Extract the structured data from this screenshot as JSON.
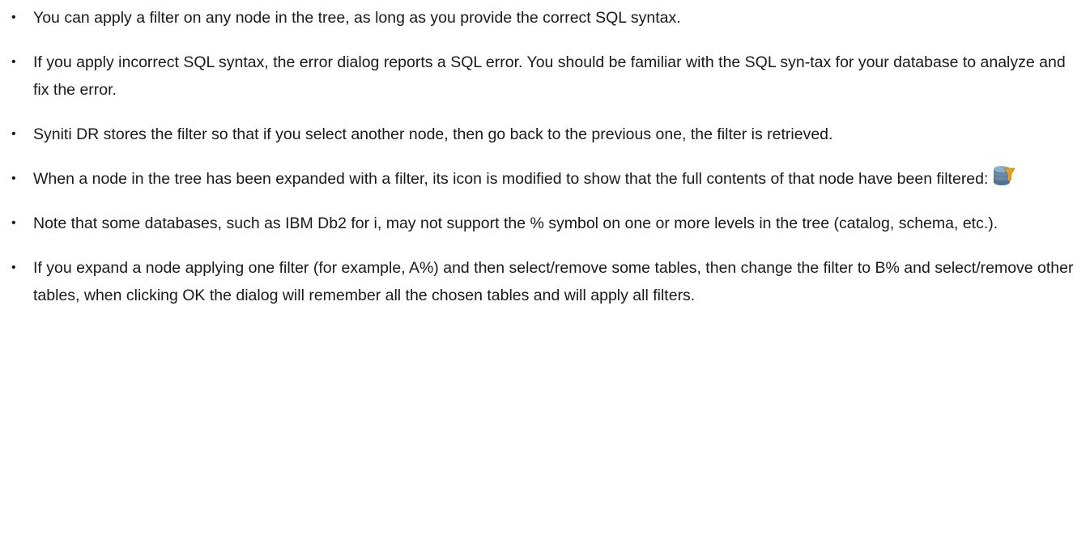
{
  "notes": {
    "items": [
      {
        "text": "You can apply a filter on any node in the tree, as long as you provide the correct SQL syntax."
      },
      {
        "text": "If you apply incorrect SQL syntax, the error dialog reports a SQL error. You should be familiar with the SQL syn-tax for your database to analyze and fix the error."
      },
      {
        "text": "Syniti DR stores the filter so that if you select another node, then go back to the previous one, the filter is retrieved."
      },
      {
        "text": "When a node in the tree has been expanded with a filter, its icon is modified to show that the full contents of that node have been filtered:",
        "icon": "database-filter-icon"
      },
      {
        "text": "Note that some databases, such as IBM Db2 for i, may not support the % symbol on one or more levels in the tree (catalog, schema, etc.)."
      },
      {
        "text": "If you expand a node applying one filter (for example, A%) and then select/remove some tables, then change the filter to B% and select/remove other tables, when clicking OK the dialog will remember all the chosen tables and will apply all filters."
      }
    ]
  },
  "colors": {
    "text": "#1a1a1a",
    "icon_db_top": "#7a9ab8",
    "icon_db_body": "#4f7394",
    "icon_funnel": "#e8a31c"
  }
}
